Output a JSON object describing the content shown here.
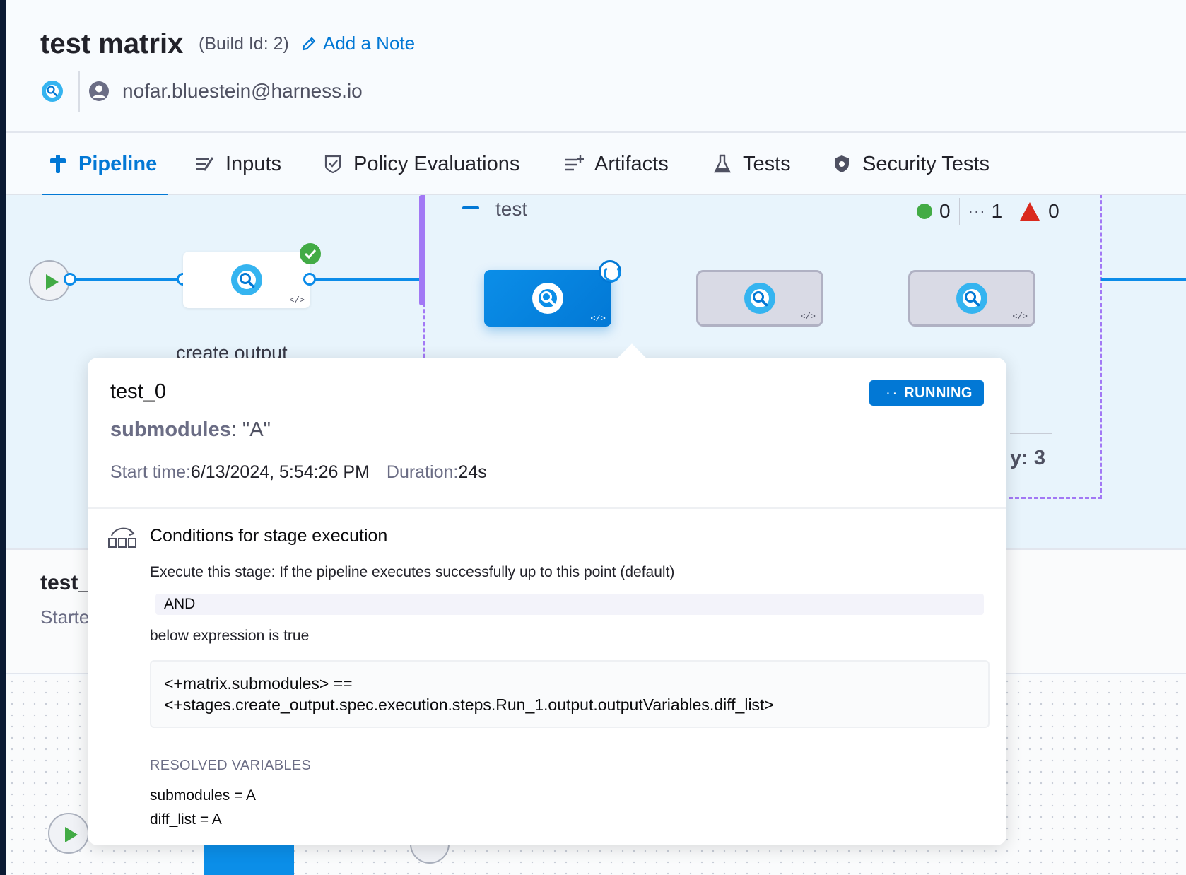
{
  "header": {
    "title": "test matrix",
    "build_id": "(Build Id: 2)",
    "add_note": "Add a Note",
    "user_email": "nofar.bluestein@harness.io"
  },
  "tabs": [
    {
      "label": "Pipeline",
      "icon": "pipeline-icon",
      "active": true
    },
    {
      "label": "Inputs",
      "icon": "inputs-icon"
    },
    {
      "label": "Policy Evaluations",
      "icon": "policy-icon"
    },
    {
      "label": "Artifacts",
      "icon": "artifacts-icon"
    },
    {
      "label": "Tests",
      "icon": "flask-icon"
    },
    {
      "label": "Security Tests",
      "icon": "shield-icon"
    }
  ],
  "canvas": {
    "stage1_label": "create output",
    "matrix_name": "test",
    "counters": {
      "success": "0",
      "running": "1",
      "failed": "0"
    },
    "code_tag": "</>",
    "parallel_label": "y: 3"
  },
  "details": {
    "title": "test_(",
    "started": "Starte"
  },
  "popover": {
    "name": "test_0",
    "status": "RUNNING",
    "matrix_key": "submodules",
    "matrix_value": ": \"A\"",
    "start_label": "Start time: ",
    "start_value": "6/13/2024, 5:54:26 PM",
    "duration_label": "Duration:",
    "duration_value": "24s",
    "conditions_title": "Conditions for stage execution",
    "execute_text": "Execute this stage: If the pipeline executes successfully up to this point (default)",
    "and_label": "AND",
    "below_text": "below expression is true",
    "expression_line1": "<+matrix.submodules> ==",
    "expression_line2": "<+stages.create_output.spec.execution.steps.Run_1.output.outputVariables.diff_list>",
    "resolved_header": "RESOLVED VARIABLES",
    "resolved": [
      "submodules = A",
      "diff_list = A"
    ]
  },
  "colors": {
    "accent": "#0278d5",
    "success": "#42ab45",
    "danger": "#da291d",
    "matrix_border": "#a278f5"
  }
}
